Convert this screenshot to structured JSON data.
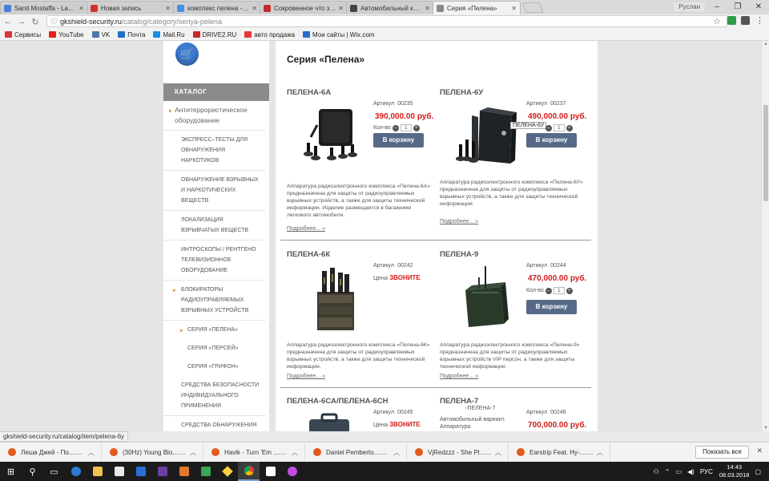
{
  "browser": {
    "tabs": [
      {
        "title": "Santi Mostaffa - Las M",
        "color": "#4a7fd6"
      },
      {
        "title": "Новая запись",
        "color": "#d0302f"
      },
      {
        "title": "комплекс пелена - Пои",
        "color": "#4a90e2"
      },
      {
        "title": "Сокровенное что за чер",
        "color": "#c42b2b"
      },
      {
        "title": "Автомобильный компл",
        "color": "#444444"
      },
      {
        "title": "Серия «Пелена»",
        "color": "#888888"
      }
    ],
    "profile": "Руслан",
    "url_host": "gkshield-security.ru",
    "url_path": "/catalog/category/seriya-pelena",
    "bookmarks": [
      {
        "label": "Сервисы",
        "color": "#d33"
      },
      {
        "label": "YouTube",
        "color": "#e62117"
      },
      {
        "label": "VK",
        "color": "#4a76a8"
      },
      {
        "label": "Почта",
        "color": "#1e73c9"
      },
      {
        "label": "Mail.Ru",
        "color": "#168de2"
      },
      {
        "label": "DRIVE2.RU",
        "color": "#c62828"
      },
      {
        "label": "авто продажа",
        "color": "#e53935"
      },
      {
        "label": "Мои сайты | Wix.com",
        "color": "#2a6acb"
      }
    ]
  },
  "sidebar": {
    "catalog_title": "КАТАЛОГ",
    "items": [
      {
        "label": "Антитеррористическое оборудование",
        "level": "top"
      },
      {
        "label": "Экспресс–тесты для обнаружения наркотиков",
        "level": "sub1"
      },
      {
        "label": "Обнаружение взрывных и наркотических веществ",
        "level": "sub1"
      },
      {
        "label": "Локализация взрывчатых веществ",
        "level": "sub1"
      },
      {
        "label": "Интроскопы / Рентгено телевизионное оборудование",
        "level": "sub1"
      },
      {
        "label": "Блокираторы радиоуправляемых взрывных устройств",
        "level": "sub1b"
      },
      {
        "label": "Серия «Пелена»",
        "level": "sub2a"
      },
      {
        "label": "Серия «Персей»",
        "level": "sub2"
      },
      {
        "label": "Серия «Грифон»",
        "level": "sub2"
      },
      {
        "label": "Средства безопасности индивидуального применения",
        "level": "sub1"
      },
      {
        "label": "Средства обнаружения радиоактивных материалов и химических веществ",
        "level": "sub1"
      }
    ]
  },
  "content": {
    "title": "Серия «Пелена»",
    "article_label": "Артикул",
    "qty_label": "Кол-во",
    "qty_value": "1",
    "cart_label": "В корзину",
    "more_label": "Подробнее... »",
    "call_prefix": "Цена",
    "call_label": "ЗВОНИТЕ",
    "products": [
      {
        "name": "ПЕЛЕНА-6А",
        "article": "00235",
        "price": "390,000.00 руб.",
        "desc": "Аппаратура радиоэлектронного комплекса «Пелена-6А» предназначена для защиты от радиоуправляемых взрывных устройств, а также для защиты технической информации. Изделие размещается в багажнике легкового автомобиля."
      },
      {
        "name": "ПЕЛЕНА-6У",
        "article": "00237",
        "price": "490,000.00 руб.",
        "desc": "Аппаратура радиоэлектронного комплекса «Пелена-6У» предназначена для защиты от радиоуправляемых взрывных устройств, а также для защиты технической информации.",
        "tooltip": "ПЕЛЕНА-6У"
      },
      {
        "name": "ПЕЛЕНА-6К",
        "article": "00242",
        "desc": "Аппаратура радиоэлектронного комплекса «Пелена-6К» предназначена для защиты от радиоуправляемых взрывных устройств, а также для защиты технической информации."
      },
      {
        "name": "ПЕЛЕНА-9",
        "article": "00244",
        "price": "470,000.00 руб.",
        "desc": "Аппаратура радиоэлектронного комплекса «Пелена-9» предназначена для защиты от радиоуправляемых взрывных устройств VIP персон, а также для защиты технической информации."
      },
      {
        "name": "ПЕЛЕНА-6СА/ПЕЛЕНА-6СН",
        "article": "00245"
      },
      {
        "name": "ПЕЛЕНА-7",
        "article": "00246",
        "price": "700,000.00 руб.",
        "img_alt": "ПЕЛЕНА-7",
        "desc": "Автомобильный вариант. Аппаратура радиоэлектронного комплекса"
      }
    ]
  },
  "status_url": "gkshield-security.ru/catalog/item/pelena-6y",
  "downloads": {
    "items": [
      "Леша Джей - По....mp3",
      "(30Hz) Young Blo....mp3",
      "Havik - Turn 'Em ....mp3",
      "Daniel Pemberto....mp3",
      "VjRedzzz - She Pl....mp3",
      "Earstrip Feat. Hy-....mp3"
    ],
    "show_all": "Показать все"
  },
  "taskbar": {
    "lang": "РУС",
    "time": "14:43",
    "date": "08.03.2018"
  }
}
